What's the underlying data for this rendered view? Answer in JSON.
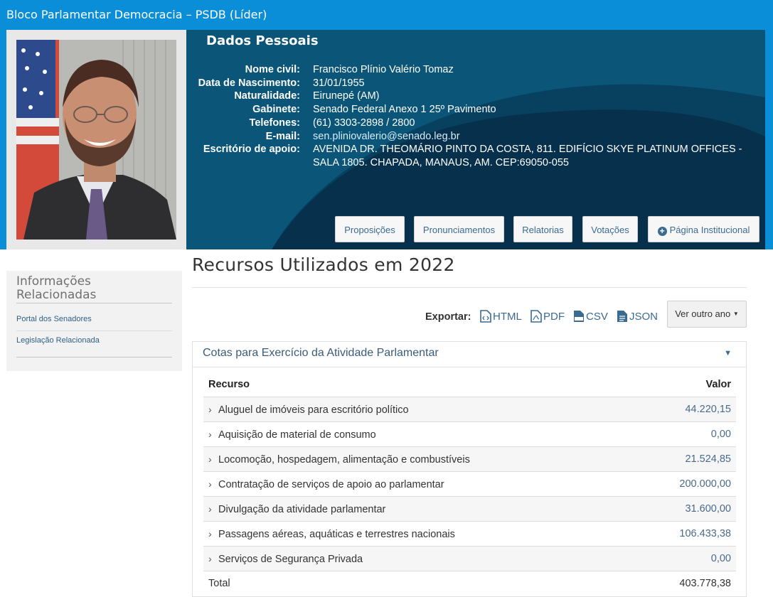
{
  "header": {
    "title": "Bloco Parlamentar Democracia – PSDB (Líder)",
    "section_title": "Dados Pessoais"
  },
  "personal": {
    "fields": [
      {
        "label": "Nome civil:",
        "value": "Francisco Plínio Valério Tomaz"
      },
      {
        "label": "Data de Nascimento:",
        "value": "31/01/1955"
      },
      {
        "label": "Naturalidade:",
        "value": "Eirunepé (AM)"
      },
      {
        "label": "Gabinete:",
        "value": "Senado Federal Anexo 1 25º Pavimento"
      },
      {
        "label": "Telefones:",
        "value": "(61) 3303-2898 / 2800"
      },
      {
        "label": "E-mail:",
        "value": "sen.pliniovalerio@senado.leg.br"
      },
      {
        "label": "Escritório de apoio:",
        "value": "AVENIDA DR. THEOMÁRIO PINTO DA COSTA, 811. EDIFÍCIO SKYE PLATINUM OFFICES - SALA 1805. CHAPADA, MANAUS, AM. CEP:69050-055"
      }
    ]
  },
  "tabs": [
    "Proposições",
    "Pronunciamentos",
    "Relatorias",
    "Votações",
    "Página Institucional"
  ],
  "sidebar": {
    "title": "Informações Relacionadas",
    "links": [
      "Portal dos Senadores",
      "Legislação Relacionada"
    ]
  },
  "main": {
    "title": "Recursos Utilizados em 2022",
    "export_label": "Exportar:",
    "export_formats": [
      "HTML",
      "PDF",
      "CSV",
      "JSON"
    ],
    "other_year_label": "Ver outro ano",
    "panel_title": "Cotas para Exercício da Atividade Parlamentar",
    "table": {
      "headers": [
        "Recurso",
        "Valor"
      ],
      "rows": [
        {
          "label": "Aluguel de imóveis para escritório político",
          "value": "44.220,15"
        },
        {
          "label": "Aquisição de material de consumo",
          "value": "0,00"
        },
        {
          "label": "Locomoção, hospedagem, alimentação e combustíveis",
          "value": "21.524,85"
        },
        {
          "label": "Contratação de serviços de apoio ao parlamentar",
          "value": "200.000,00"
        },
        {
          "label": "Divulgação da atividade parlamentar",
          "value": "31.600,00"
        },
        {
          "label": "Passagens aéreas, aquáticas e terrestres nacionais",
          "value": "106.433,38"
        },
        {
          "label": "Serviços de Segurança Privada",
          "value": "0,00"
        }
      ],
      "total_label": "Total",
      "total_value": "403.778,38"
    }
  },
  "colors": {
    "top_bar": "#0b8ed8",
    "hero_dark": "#0a3a5c",
    "link": "#3b6b91"
  }
}
